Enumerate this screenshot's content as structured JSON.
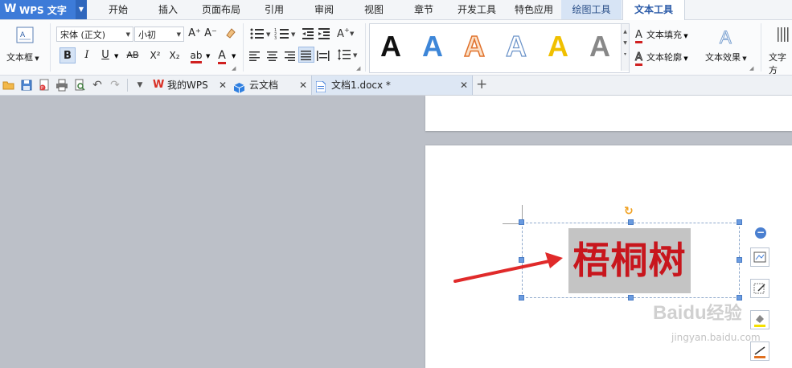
{
  "app": {
    "logo_text": "W",
    "name": "WPS 文字",
    "dropdown": "▼"
  },
  "menu_tabs": [
    "开始",
    "插入",
    "页面布局",
    "引用",
    "审阅",
    "视图",
    "章节",
    "开发工具",
    "特色应用",
    "绘图工具",
    "文本工具"
  ],
  "ribbon": {
    "textbox_label": "文本框",
    "font_name": "宋体 (正文)",
    "font_size": "小初",
    "grow_font": "A⁺",
    "shrink_font": "A⁻",
    "bold": "B",
    "italic": "I",
    "underline": "U",
    "strike": "AB",
    "superscript": "X²",
    "subscript": "X₂",
    "highlight": "ab",
    "font_color": "A",
    "style_letter": "A",
    "text_fill": "文本填充",
    "text_outline": "文本轮廓",
    "text_effect": "文本效果",
    "text_direction": "文字方",
    "accent_color": "#d02020"
  },
  "doc_tabs": [
    {
      "label": "我的WPS",
      "icon": "wps-logo-icon"
    },
    {
      "label": "云文档",
      "icon": "cloud-cube-icon"
    },
    {
      "label": "文档1.docx *",
      "icon": "doc-icon"
    }
  ],
  "document": {
    "textbox_text": "梧桐树",
    "text_color": "#c8161d",
    "highlight_color": "#c4c4c4"
  },
  "watermark": {
    "brand": "Baidu",
    "brand_cn": "经验",
    "url": "jingyan.baidu.com"
  }
}
